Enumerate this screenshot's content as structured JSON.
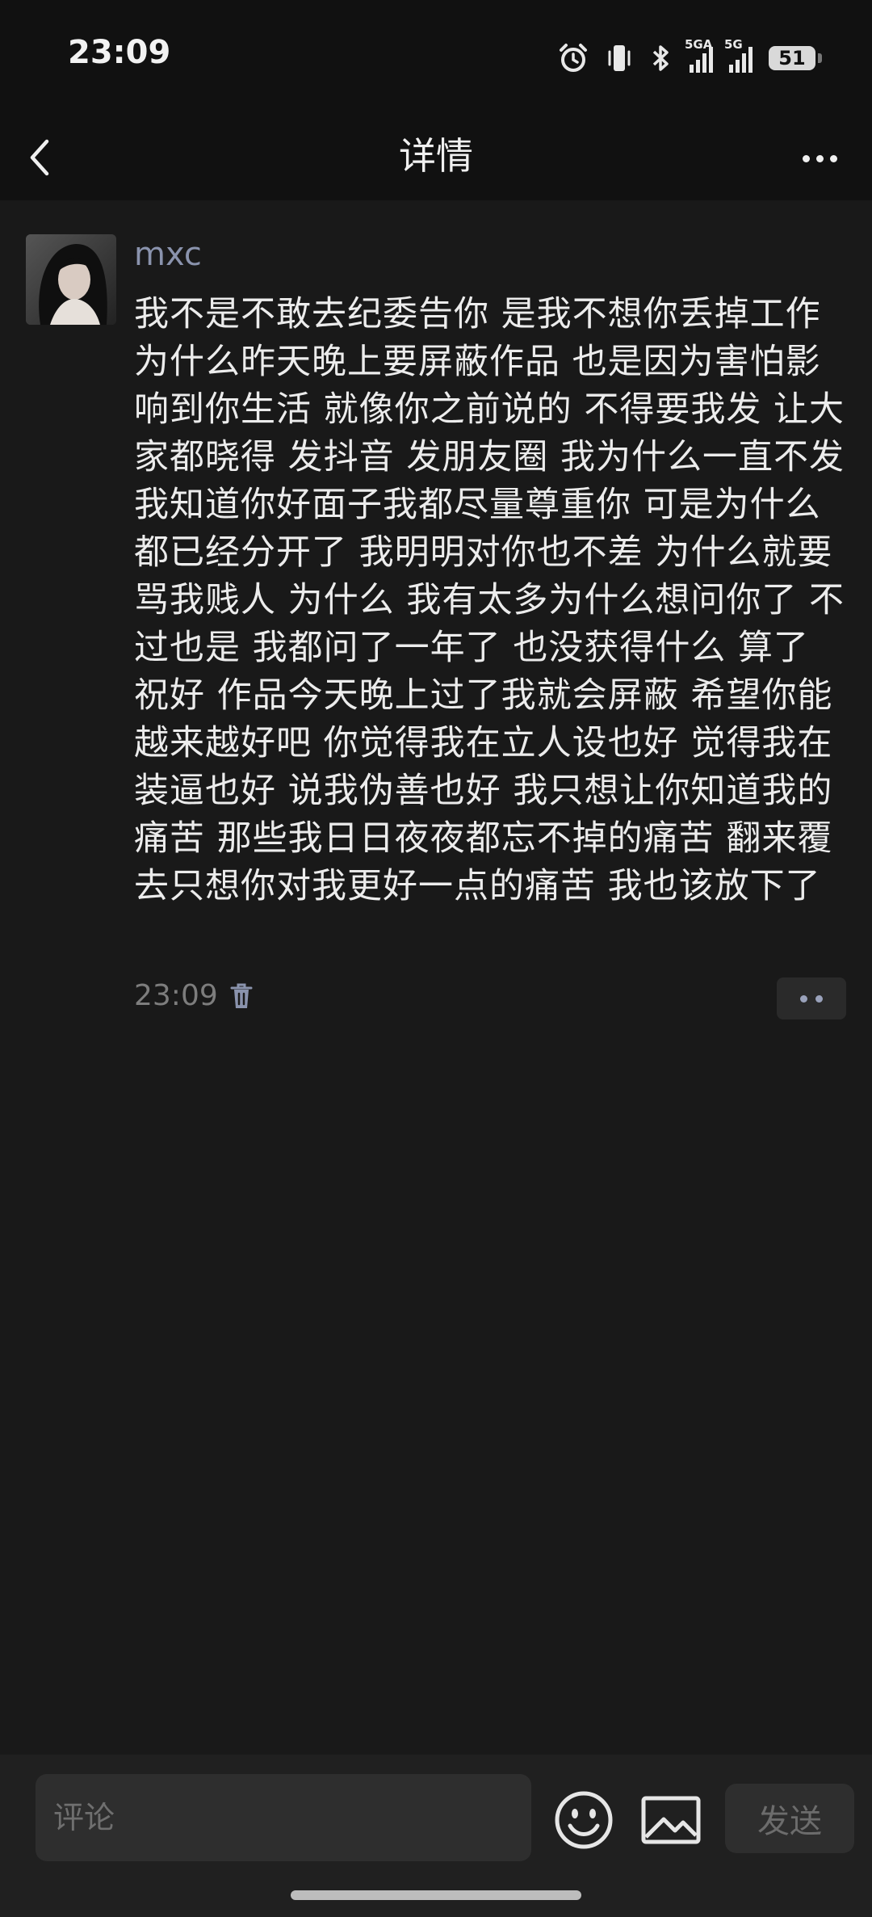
{
  "status_bar": {
    "time": "23:09",
    "signal1_label": "5GA",
    "signal2_label": "5G",
    "battery": "51",
    "icons": [
      "alarm-icon",
      "vibrate-icon",
      "bluetooth-icon",
      "signal-icon",
      "signal-icon",
      "battery-icon"
    ]
  },
  "nav": {
    "title": "详情",
    "back_icon": "chevron-left-icon",
    "more_icon": "more-horizontal-icon"
  },
  "post": {
    "username": "mxc",
    "text": "我不是不敢去纪委告你 是我不想你丢掉工作 为什么昨天晚上要屏蔽作品 也是因为害怕影响到你生活 就像你之前说的 不得要我发 让大家都晓得 发抖音 发朋友圈 我为什么一直不发 我知道你好面子我都尽量尊重你 可是为什么都已经分开了 我明明对你也不差 为什么就要骂我贱人 为什么 我有太多为什么想问你了 不过也是 我都问了一年了 也没获得什么 算了 祝好 作品今天晚上过了我就会屏蔽 希望你能越来越好吧 你觉得我在立人设也好 觉得我在装逼也好 说我伪善也好 我只想让你知道我的痛苦 那些我日日夜夜都忘不掉的痛苦 翻来覆去只想你对我更好一点的痛苦 我也该放下了",
    "time": "23:09",
    "delete_icon": "trash-icon"
  },
  "comment_bar": {
    "placeholder": "评论",
    "send_label": "发送",
    "emoji_icon": "emoji-icon",
    "image_icon": "image-icon"
  },
  "colors": {
    "background": "#191919",
    "header": "#111111",
    "username": "#8a93ad",
    "text": "#ececec"
  }
}
